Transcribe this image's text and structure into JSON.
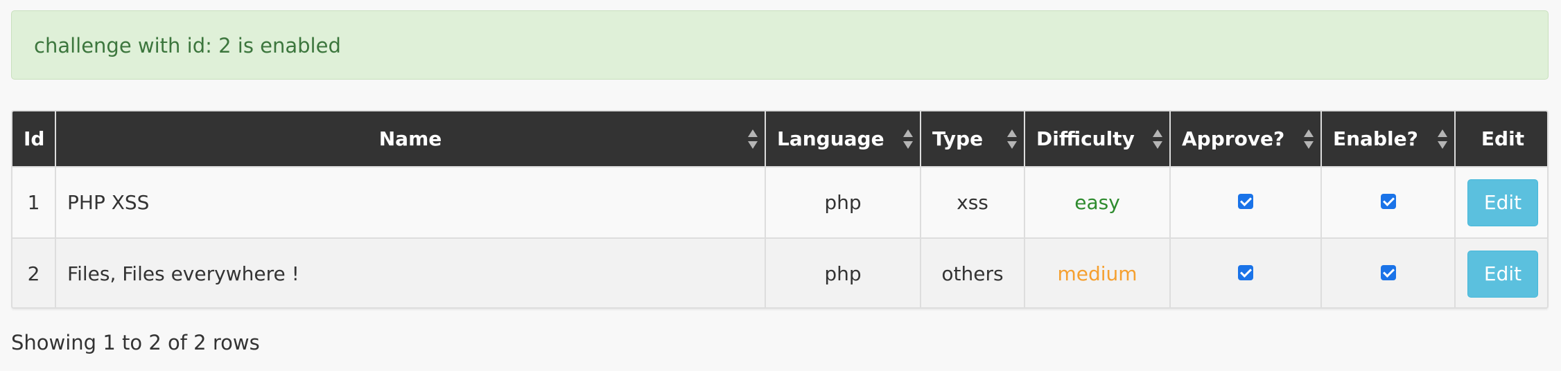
{
  "alert": {
    "message": "challenge with id: 2 is enabled"
  },
  "table": {
    "columns": [
      {
        "label": "Id",
        "sortable": false
      },
      {
        "label": "Name",
        "sortable": true
      },
      {
        "label": "Language",
        "sortable": true
      },
      {
        "label": "Type",
        "sortable": true
      },
      {
        "label": "Difficulty",
        "sortable": true
      },
      {
        "label": "Approve?",
        "sortable": true
      },
      {
        "label": "Enable?",
        "sortable": true
      },
      {
        "label": "Edit",
        "sortable": false
      }
    ],
    "rows": [
      {
        "id": "1",
        "name": "PHP XSS",
        "language": "php",
        "type": "xss",
        "difficulty": "easy",
        "difficulty_color": "#2e8b2e",
        "approved": true,
        "enabled": true,
        "edit_label": "Edit"
      },
      {
        "id": "2",
        "name": "Files, Files everywhere !",
        "language": "php",
        "type": "others",
        "difficulty": "medium",
        "difficulty_color": "#f5a030",
        "approved": true,
        "enabled": true,
        "edit_label": "Edit"
      }
    ]
  },
  "pagination": {
    "info": "Showing 1 to 2 of 2 rows"
  },
  "colors": {
    "alert_bg": "#dff0d8",
    "alert_text": "#3c763d",
    "header_bg": "#333333",
    "edit_button": "#5bc0de",
    "checkbox": "#1a73e8"
  },
  "icons": {
    "sort": "sort-both-icon",
    "checkbox": "checkbox-checked-icon"
  }
}
